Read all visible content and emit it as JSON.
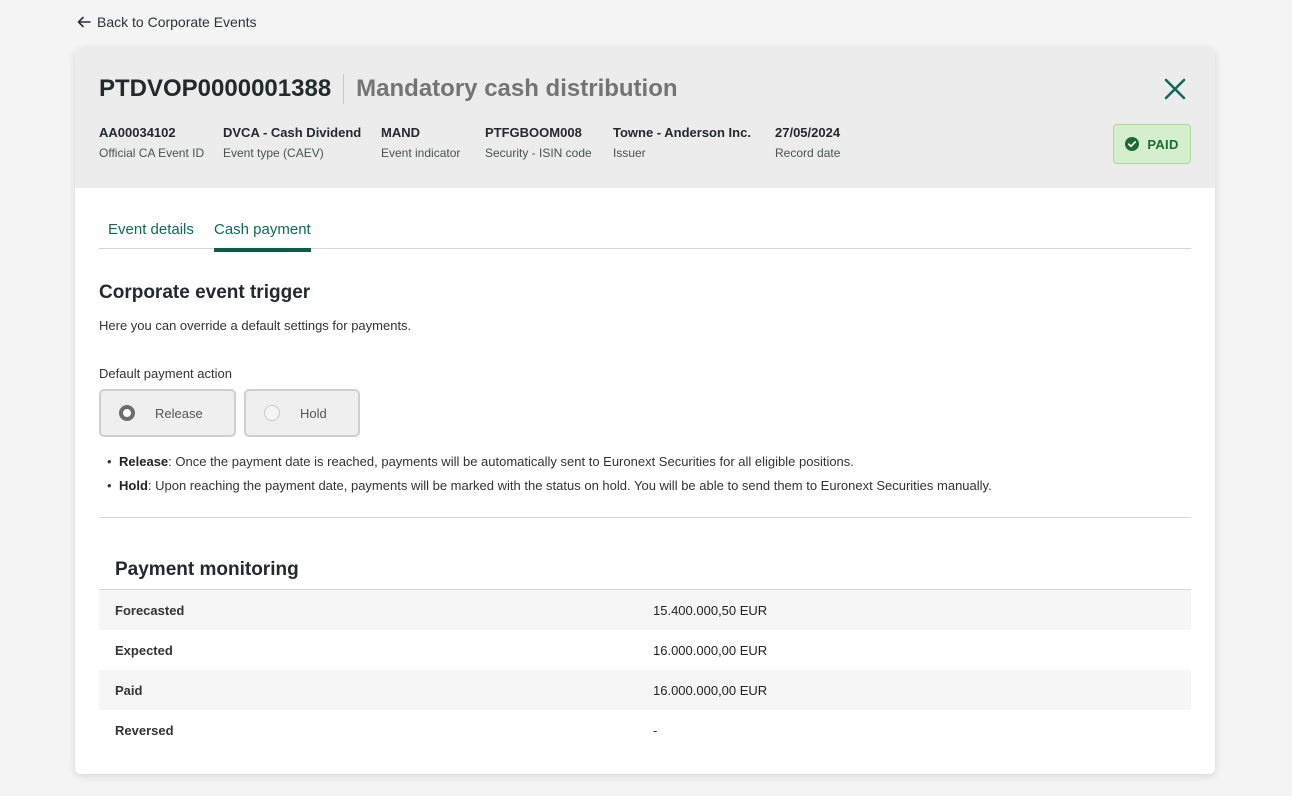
{
  "nav": {
    "back_label": "Back to Corporate Events"
  },
  "header": {
    "event_code": "PTDVOP0000001388",
    "event_name": "Mandatory cash distribution",
    "meta": [
      {
        "value": "AA00034102",
        "label": "Official CA Event ID"
      },
      {
        "value": "DVCA - Cash Dividend",
        "label": "Event type (CAEV)"
      },
      {
        "value": "MAND",
        "label": "Event indicator"
      },
      {
        "value": "PTFGBOOM008",
        "label": "Security - ISIN code"
      },
      {
        "value": "Towne - Anderson Inc.",
        "label": "Issuer"
      },
      {
        "value": "27/05/2024",
        "label": "Record date"
      }
    ],
    "status": {
      "label": "PAID",
      "color": "#1c6b31",
      "icon": "check-circle-icon"
    },
    "close_icon": "close-icon"
  },
  "tabs": [
    {
      "label": "Event details",
      "active": false
    },
    {
      "label": "Cash payment",
      "active": true
    }
  ],
  "trigger": {
    "title": "Corporate event trigger",
    "description": "Here you can override a default settings for payments.",
    "field_label": "Default payment action",
    "options": [
      {
        "label": "Release",
        "selected": true
      },
      {
        "label": "Hold",
        "selected": false
      }
    ],
    "bullets": [
      {
        "term": "Release",
        "text": ": Once the payment date is reached, payments will be automatically sent to Euronext Securities for all eligible positions."
      },
      {
        "term": "Hold",
        "text": ": Upon reaching the payment date, payments will be marked with the status on hold. You will be able to send them to Euronext Securities manually."
      }
    ]
  },
  "monitoring": {
    "title": "Payment monitoring",
    "rows": [
      {
        "label": "Forecasted",
        "value": "15.400.000,50 EUR"
      },
      {
        "label": "Expected",
        "value": "16.000.000,00 EUR"
      },
      {
        "label": "Paid",
        "value": "16.000.000,00 EUR"
      },
      {
        "label": "Reversed",
        "value": "-"
      }
    ]
  },
  "colors": {
    "accent": "#0d6b57",
    "status_bg": "#d5efcc"
  }
}
